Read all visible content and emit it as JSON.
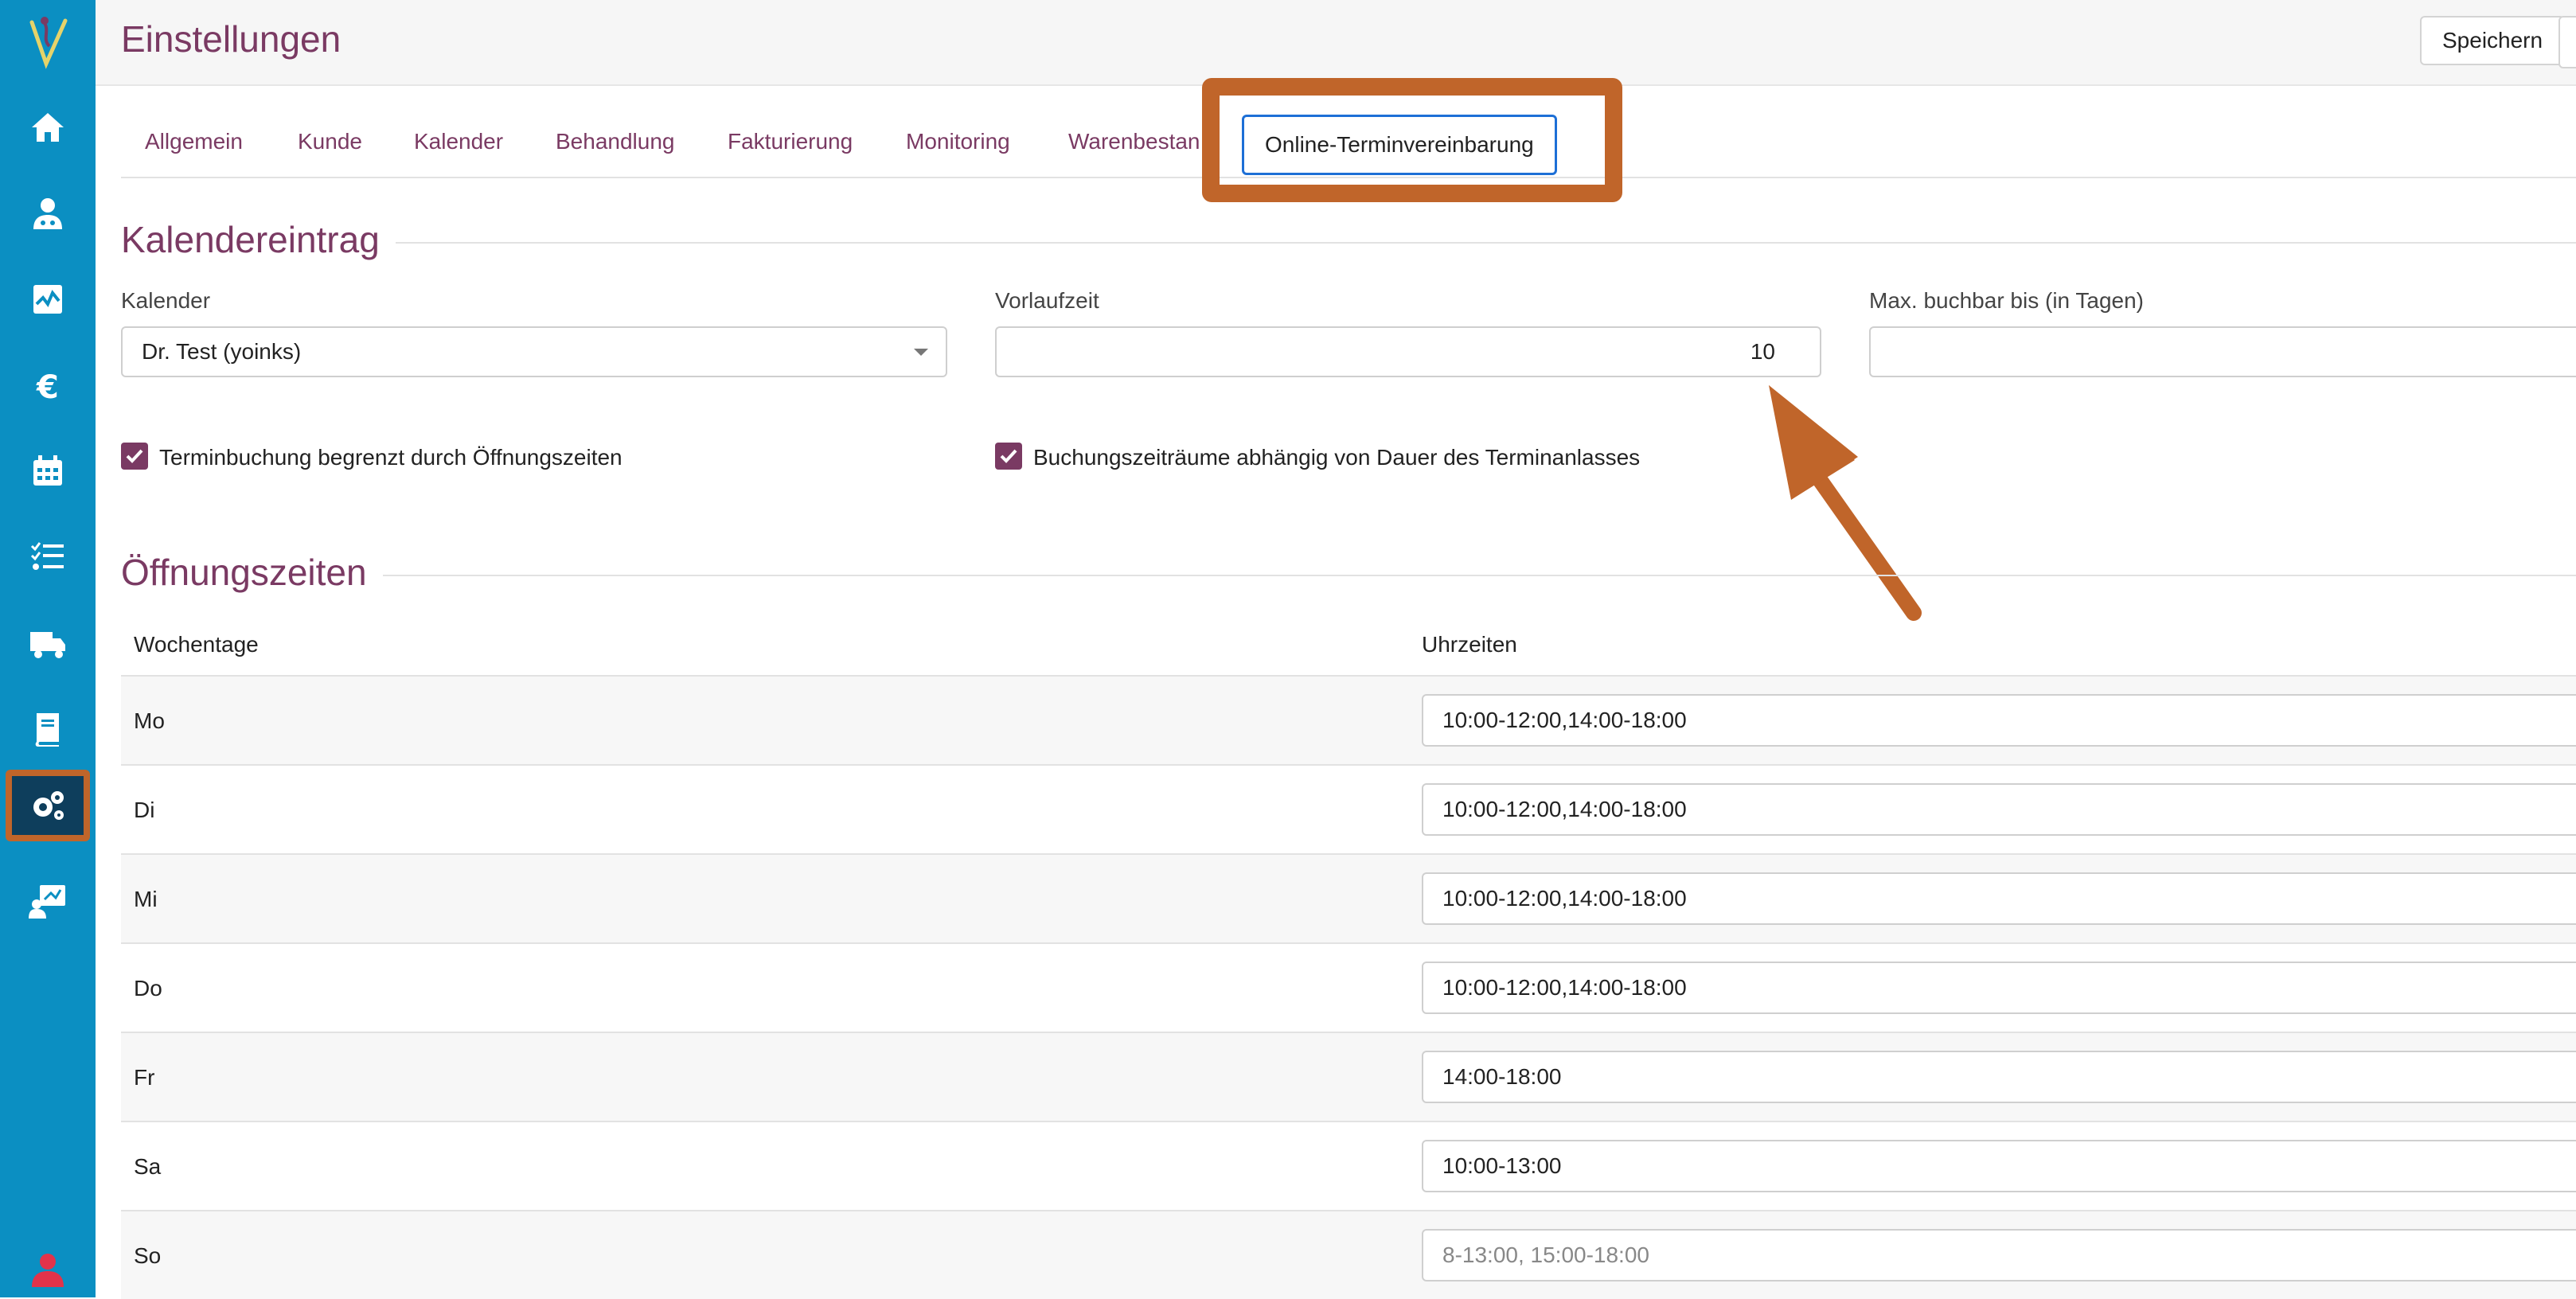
{
  "header": {
    "title": "Einstellungen",
    "save_label": "Speichern"
  },
  "sidebar": {
    "items": [
      {
        "icon": "home-icon"
      },
      {
        "icon": "customer-doctor-icon"
      },
      {
        "icon": "monitor-chart-icon"
      },
      {
        "icon": "euro-icon"
      },
      {
        "icon": "calendar-icon"
      },
      {
        "icon": "checklist-icon"
      },
      {
        "icon": "truck-icon"
      },
      {
        "icon": "book-icon"
      },
      {
        "icon": "gears-icon",
        "active": true
      },
      {
        "icon": "presentation-user-icon"
      },
      {
        "icon": "user-icon"
      }
    ]
  },
  "tabs": {
    "items": [
      "Allgemein",
      "Kunde",
      "Kalender",
      "Behandlung",
      "Fakturierung",
      "Monitoring",
      "Warenbestan"
    ],
    "active": "Online-Terminvereinbarung"
  },
  "calendar_entry": {
    "title": "Kalendereintrag",
    "calendar_label": "Kalender",
    "calendar_value": "Dr. Test (yoinks)",
    "lead_time_label": "Vorlaufzeit",
    "lead_time_value": "10",
    "max_days_label": "Max. buchbar bis (in Tagen)",
    "max_days_value": "",
    "checkbox_opening_hours": "Terminbuchung begrenzt durch Öffnungszeiten",
    "checkbox_duration": "Buchungszeiträume abhängig von Dauer des Terminanlasses"
  },
  "opening_hours": {
    "title": "Öffnungszeiten",
    "col_days": "Wochentage",
    "col_times": "Uhrzeiten",
    "rows": [
      {
        "day": "Mo",
        "times": "10:00-12:00,14:00-18:00"
      },
      {
        "day": "Di",
        "times": "10:00-12:00,14:00-18:00"
      },
      {
        "day": "Mi",
        "times": "10:00-12:00,14:00-18:00"
      },
      {
        "day": "Do",
        "times": "10:00-12:00,14:00-18:00"
      },
      {
        "day": "Fr",
        "times": "14:00-18:00"
      },
      {
        "day": "Sa",
        "times": "10:00-13:00"
      },
      {
        "day": "So",
        "times": "",
        "placeholder": "8-13:00, 15:00-18:00"
      }
    ]
  },
  "colors": {
    "sidebar": "#0b8fc2",
    "accent": "#7a3a63",
    "highlight": "#c0652a",
    "focus": "#1d6fd6"
  }
}
